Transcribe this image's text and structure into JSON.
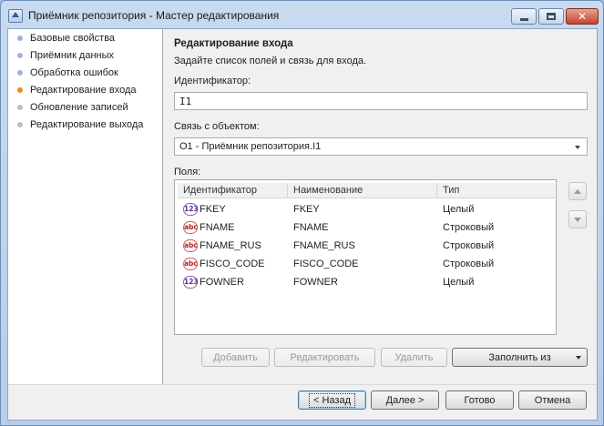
{
  "window": {
    "title": "Приёмник репозитория - Мастер редактирования"
  },
  "sidebar": {
    "items": [
      {
        "label": "Базовые свойства",
        "state": "done"
      },
      {
        "label": "Приёмник данных",
        "state": "done"
      },
      {
        "label": "Обработка ошибок",
        "state": "done"
      },
      {
        "label": "Редактирование входа",
        "state": "active"
      },
      {
        "label": "Обновление записей",
        "state": "pending"
      },
      {
        "label": "Редактирование выхода",
        "state": "pending"
      }
    ]
  },
  "main": {
    "heading": "Редактирование входа",
    "subtitle": "Задайте список полей и связь для входа.",
    "identifier_label": "Идентификатор:",
    "identifier_value": "I1",
    "link_label": "Связь с объектом:",
    "link_value": "O1 - Приёмник репозитория.I1",
    "fields_label": "Поля:",
    "grid": {
      "columns": [
        "Идентификатор",
        "Наименование",
        "Тип"
      ],
      "rows": [
        {
          "icon": "integer-type-icon",
          "icon_text": "123",
          "id": "FKEY",
          "name": "FKEY",
          "type": "Целый"
        },
        {
          "icon": "string-type-icon",
          "icon_text": "abc",
          "id": "FNAME",
          "name": "FNAME",
          "type": "Строковый"
        },
        {
          "icon": "string-type-icon",
          "icon_text": "abc",
          "id": "FNAME_RUS",
          "name": "FNAME_RUS",
          "type": "Строковый"
        },
        {
          "icon": "string-type-icon",
          "icon_text": "abc",
          "id": "FISCO_CODE",
          "name": "FISCO_CODE",
          "type": "Строковый"
        },
        {
          "icon": "integer-type-icon",
          "icon_text": "123",
          "id": "FOWNER",
          "name": "FOWNER",
          "type": "Целый"
        }
      ]
    },
    "buttons": {
      "add": "Добавить",
      "edit": "Редактировать",
      "delete": "Удалить",
      "fill_from": "Заполнить из"
    }
  },
  "footer": {
    "back": "< Назад",
    "next": "Далее >",
    "finish": "Готово",
    "cancel": "Отмена"
  },
  "colors": {
    "active_step": "#ef8a1f",
    "done_step": "#9fb4cf",
    "pending_step": "#bdbdbd"
  }
}
